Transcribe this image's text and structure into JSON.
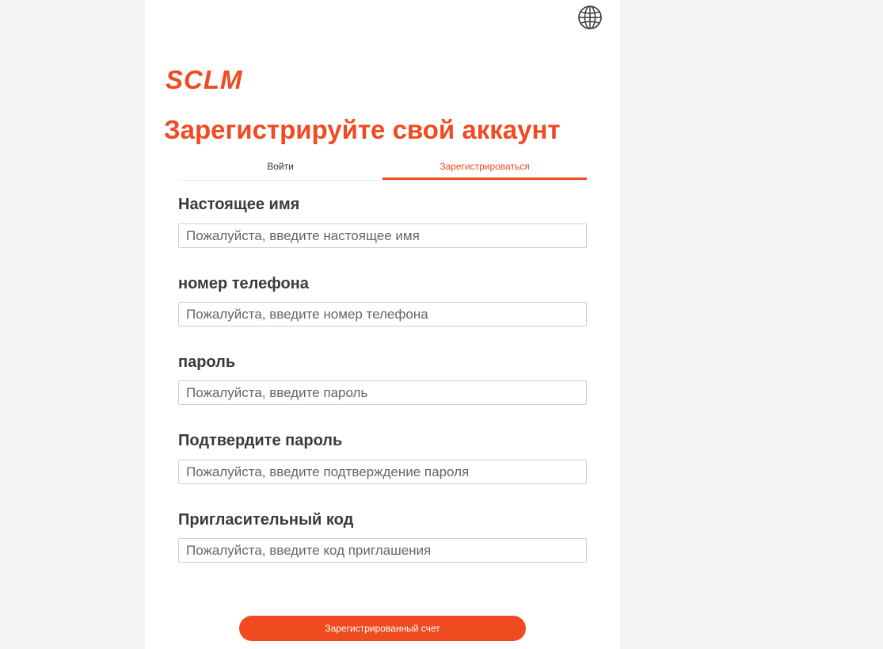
{
  "header": {
    "language_icon": "globe-icon",
    "logo": "SCLM",
    "title": "Зарегистрируйте свой аккаунт"
  },
  "tabs": [
    {
      "label": "Войти",
      "active": false
    },
    {
      "label": "Зарегистрироваться",
      "active": true
    }
  ],
  "form": {
    "fields": [
      {
        "label": "Настоящее имя",
        "placeholder": "Пожалуйста, введите настоящее имя",
        "value": ""
      },
      {
        "label": "номер телефона",
        "placeholder": "Пожалуйста, введите номер телефона",
        "value": ""
      },
      {
        "label": "пароль",
        "placeholder": "Пожалуйста, введите пароль",
        "value": ""
      },
      {
        "label": "Подтвердите пароль",
        "placeholder": "Пожалуйста, введите подтверждение пароля",
        "value": ""
      },
      {
        "label": "Пригласительный код",
        "placeholder": "Пожалуйста, введите код приглашения",
        "value": ""
      }
    ],
    "submit_label": "Зарегистрированный счет"
  },
  "colors": {
    "accent": "#f04a21",
    "background": "#f4f4f4",
    "panel": "#ffffff"
  }
}
